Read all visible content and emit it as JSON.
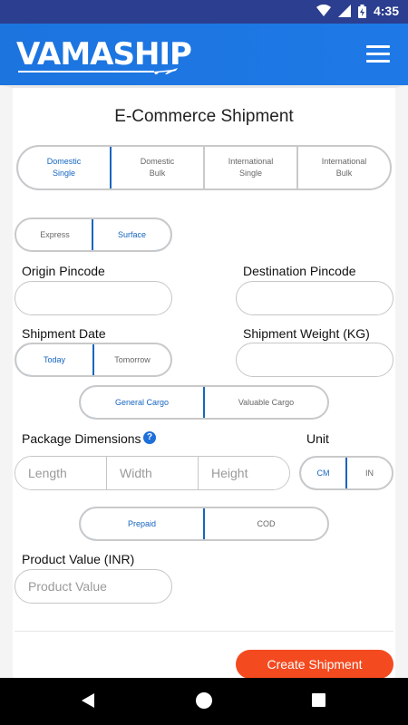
{
  "status_bar": {
    "time": "4:35"
  },
  "header": {
    "logo": "VAMASHIP"
  },
  "page": {
    "title": "E-Commerce Shipment"
  },
  "shipment_type": {
    "options": [
      {
        "line1": "Domestic",
        "line2": "Single"
      },
      {
        "line1": "Domestic",
        "line2": "Bulk"
      },
      {
        "line1": "International",
        "line2": "Single"
      },
      {
        "line1": "International",
        "line2": "Bulk"
      }
    ],
    "selected": "Domestic Single"
  },
  "mode": {
    "options": [
      "Express",
      "Surface"
    ],
    "selected": "Surface"
  },
  "origin_pincode": {
    "label": "Origin Pincode",
    "value": ""
  },
  "destination_pincode": {
    "label": "Destination Pincode",
    "value": ""
  },
  "shipment_date": {
    "label": "Shipment Date",
    "options": [
      "Today",
      "Tomorrow"
    ],
    "selected": "Today"
  },
  "shipment_weight": {
    "label": "Shipment Weight (KG)",
    "value": ""
  },
  "cargo": {
    "options": [
      "General Cargo",
      "Valuable Cargo"
    ],
    "selected": "General Cargo"
  },
  "package_dimensions": {
    "label": "Package Dimensions",
    "help_icon": "?",
    "length_placeholder": "Length",
    "width_placeholder": "Width",
    "height_placeholder": "Height"
  },
  "unit": {
    "label": "Unit",
    "options": [
      "CM",
      "IN"
    ],
    "selected": "CM"
  },
  "payment": {
    "options": [
      "Prepaid",
      "COD"
    ],
    "selected": "Prepaid"
  },
  "product_value": {
    "label": "Product Value (INR)",
    "placeholder": "Product Value"
  },
  "actions": {
    "create_label": "Create Shipment"
  },
  "colors": {
    "header": "#1c74df",
    "status_bar": "#2b3e8f",
    "accent": "#1565c0",
    "cta": "#f44a1f"
  }
}
